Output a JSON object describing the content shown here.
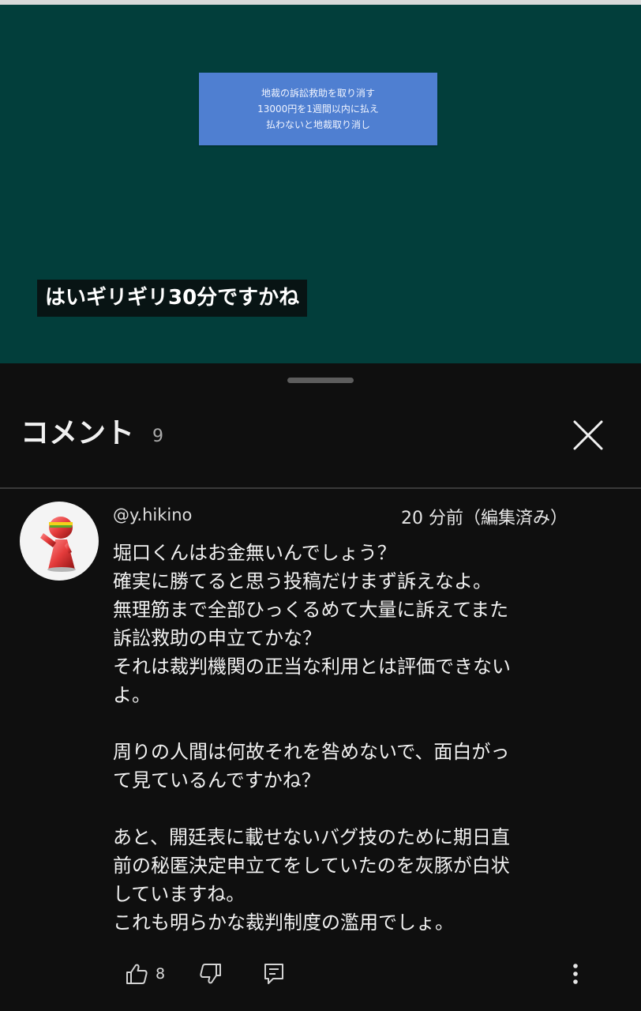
{
  "video": {
    "slide_lines": [
      "地裁の訴訟救助を取り消す",
      "13000円を1週間以内に払え",
      "払わないと地裁取り消し"
    ],
    "caption": "はいギリギリ30分ですかね"
  },
  "comments_panel": {
    "title": "コメント",
    "count": "9",
    "close_icon": "close-icon"
  },
  "comment": {
    "author": "@y.hikino",
    "timestamp": "20 分前（編集済み）",
    "lines": [
      "堀口くんはお金無いんでしょう？",
      "確実に勝てると思う投稿だけまず訴えなよ。",
      "無理筋まで全部ひっくるめて大量に訴えてまた",
      "訴訟救助の申立てかな？",
      "それは裁判機関の正当な利用とは評価できない",
      "よ。",
      "",
      "周りの人間は何故それを咎めないで、面白がっ",
      "て見ているんですかね？",
      "",
      "あと、開廷表に載せないバグ技のために期日直",
      "前の秘匿決定申立てをしていたのを灰豚が白状",
      "していますね。",
      "これも明らかな裁判制度の濫用でしょ。"
    ],
    "likes": "8",
    "icons": {
      "like": "thumbs-up-icon",
      "dislike": "thumbs-down-icon",
      "reply": "reply-icon",
      "more": "more-vertical-icon"
    }
  },
  "colors": {
    "video_bg": "#023e3b",
    "slide_bg": "#4f7fd1",
    "sheet_bg": "#0f0f0f",
    "text_primary": "#f1f1f1",
    "text_secondary": "#aaaaaa"
  }
}
